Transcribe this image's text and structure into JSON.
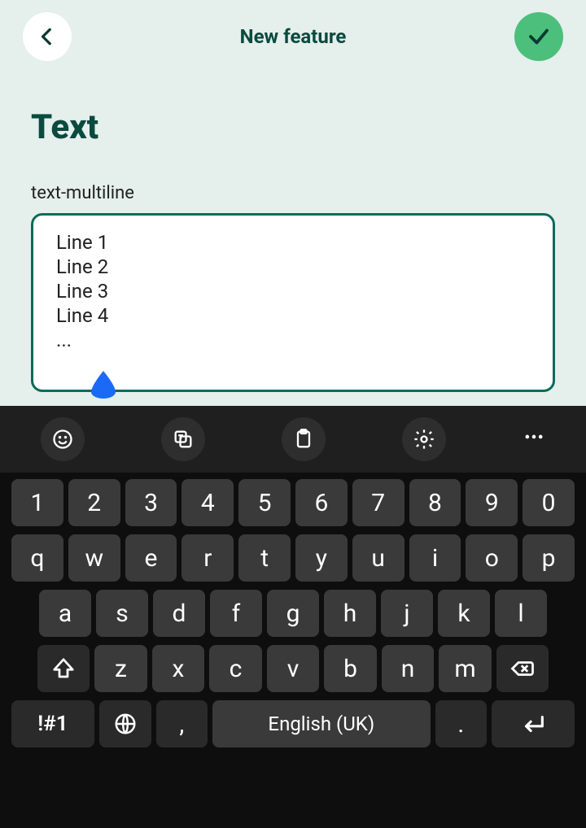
{
  "header": {
    "title": "New feature"
  },
  "page": {
    "title": "Text"
  },
  "field": {
    "label": "text-multiline",
    "value": "Line 1\nLine 2\nLine 3\nLine 4\n..."
  },
  "keyboard": {
    "row_num": [
      "1",
      "2",
      "3",
      "4",
      "5",
      "6",
      "7",
      "8",
      "9",
      "0"
    ],
    "row_q": [
      "q",
      "w",
      "e",
      "r",
      "t",
      "y",
      "u",
      "i",
      "o",
      "p"
    ],
    "row_a": [
      "a",
      "s",
      "d",
      "f",
      "g",
      "h",
      "j",
      "k",
      "l"
    ],
    "row_z": [
      "z",
      "x",
      "c",
      "v",
      "b",
      "n",
      "m"
    ],
    "sym": "!#1",
    "comma": ",",
    "space": "English (UK)",
    "period": "."
  }
}
